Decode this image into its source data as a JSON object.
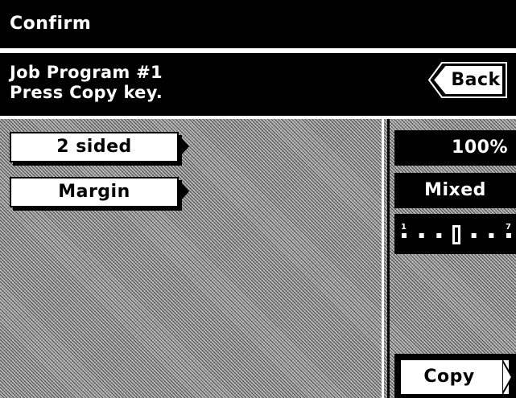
{
  "header": {
    "title": "Confirm"
  },
  "message": {
    "line1": "Job Program #1",
    "line2": "Press Copy key."
  },
  "buttons": {
    "back": "Back",
    "copy": "Copy"
  },
  "functions": [
    {
      "label": "2 sided"
    },
    {
      "label": "Margin"
    }
  ],
  "status": {
    "zoom": "100%",
    "mode": "Mixed",
    "density": {
      "min_label": "1",
      "max_label": "7",
      "level": 4,
      "steps": 7
    }
  },
  "colors": {
    "background": "#a8a8a8",
    "bar": "#000000",
    "button_face": "#ffffff"
  }
}
